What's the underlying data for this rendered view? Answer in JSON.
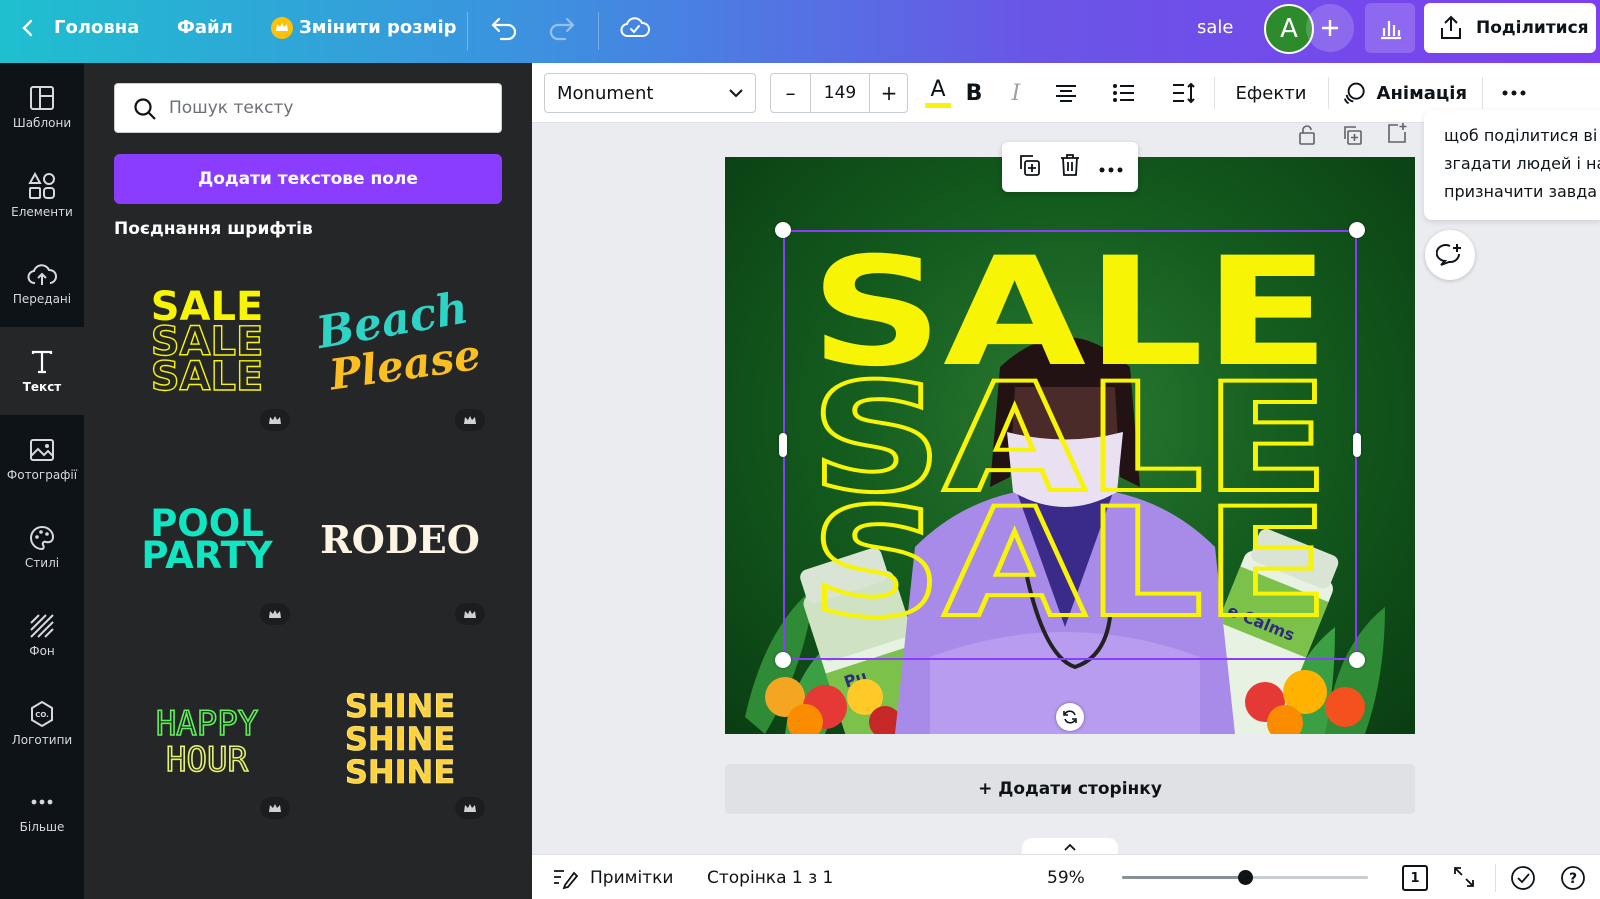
{
  "topbar": {
    "home": "Головна",
    "file": "Файл",
    "resize": "Змінити розмір",
    "doc_title": "sale",
    "avatar_initial": "A",
    "share": "Поділитися"
  },
  "rail": {
    "items": [
      {
        "label": "Шаблони",
        "icon": "templates-icon"
      },
      {
        "label": "Елементи",
        "icon": "elements-icon"
      },
      {
        "label": "Передані",
        "icon": "uploads-icon"
      },
      {
        "label": "Текст",
        "icon": "text-icon"
      },
      {
        "label": "Фотографії",
        "icon": "photos-icon"
      },
      {
        "label": "Стилі",
        "icon": "styles-icon"
      },
      {
        "label": "Фон",
        "icon": "background-icon"
      },
      {
        "label": "Логотипи",
        "icon": "logos-icon"
      },
      {
        "label": "Більше",
        "icon": "more-icon"
      }
    ]
  },
  "panel": {
    "search_placeholder": "Пошук тексту",
    "add_text_button": "Додати текстове поле",
    "combos_heading": "Поєднання шрифтів",
    "tiles": {
      "sale": [
        "SALE",
        "SALE",
        "SALE"
      ],
      "beach": [
        "Beach",
        "Please"
      ],
      "pool": [
        "POOL",
        "PARTY"
      ],
      "rodeo": "RODEO",
      "happy": [
        "HAPPY",
        "HOUR"
      ],
      "shine": [
        "SHINE",
        "SHINE",
        "SHINE"
      ]
    }
  },
  "toolbar": {
    "font": "Monument",
    "size": "149",
    "minus": "–",
    "plus": "+",
    "bold": "B",
    "italic": "I",
    "text_color_glyph": "A",
    "effects": "Ефекти",
    "animation": "Анімація"
  },
  "canvas": {
    "sale_lines": [
      "SALE",
      "SALE",
      "SALE"
    ],
    "bottle_left": "Pu",
    "bottle_right": "e Calms",
    "add_page": "+ Додати сторінку"
  },
  "comment_popover": {
    "lines": [
      "щоб поділитися ві",
      "згадати людей і на",
      "призначити завда"
    ]
  },
  "bottombar": {
    "notes": "Примітки",
    "page": "Сторінка 1 з 1",
    "zoom": "59%",
    "page_count": "1",
    "zoom_level": 0.5
  },
  "colors": {
    "accent": "#8b3dff",
    "sale_yellow": "#f7f405",
    "selection": "#8b3dff"
  }
}
